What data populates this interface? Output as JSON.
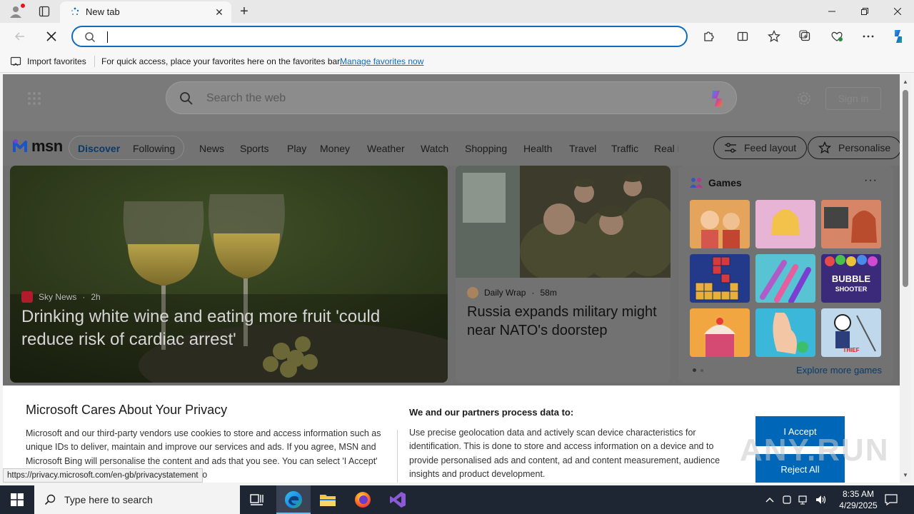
{
  "browser": {
    "tab": {
      "title": "New tab"
    },
    "address_bar": {
      "value": ""
    },
    "favorites_bar": {
      "import_label": "Import favorites",
      "hint": "For quick access, place your favorites here on the favorites bar.",
      "manage_link": "Manage favorites now"
    },
    "status_url": "https://privacy.microsoft.com/en-gb/privacystatement"
  },
  "msn": {
    "search_placeholder": "Search the web",
    "sign_in": "Sign in",
    "logo_text": "msn",
    "nav": {
      "discover": "Discover",
      "following": "Following",
      "categories": [
        "News",
        "Sports",
        "Play",
        "Money",
        "Weather",
        "Watch",
        "Shopping",
        "Health",
        "Travel",
        "Traffic",
        "Real Estate"
      ],
      "feed_layout": "Feed layout",
      "personalise": "Personalise"
    },
    "main_story": {
      "source": "Sky News",
      "age": "2h",
      "headline": "Drinking white wine and eating more fruit 'could reduce risk of cardiac arrest'"
    },
    "second_story": {
      "source": "Daily Wrap",
      "age": "58m",
      "headline": "Russia expands military might near NATO's doorstep"
    },
    "games": {
      "title": "Games",
      "more": "···",
      "tile_bubble_line1": "BUBBLE",
      "tile_bubble_line2": "SHOOTER",
      "tile_thief": "THIEF",
      "explore": "Explore more games"
    }
  },
  "privacy": {
    "title": "Microsoft Cares About Your Privacy",
    "body": "Microsoft and our third-party vendors use cookies to store and access information such as unique IDs to deliver, maintain and improve our services and ads. If you agree, MSN and Microsoft Bing will personalise the content and ads that you see. You can select 'I Accept' to consent or click on 'Manage preferences' to",
    "partners_title": "We and our partners process data to:",
    "partners_body": "Use precise geolocation data and actively scan device characteristics for identification. This is done to store and access information on a device and to provide personalised ads and content, ad and content measurement, audience insights and product development.",
    "accept": "I Accept",
    "reject": "Reject All",
    "watermark": "ANY.RUN"
  },
  "taskbar": {
    "search_placeholder": "Type here to search",
    "time": "8:35 AM",
    "date": "4/29/2025"
  },
  "colors": {
    "accent": "#0f6cbd",
    "banner_button": "#0067b8",
    "taskbar": "#1f2633"
  }
}
